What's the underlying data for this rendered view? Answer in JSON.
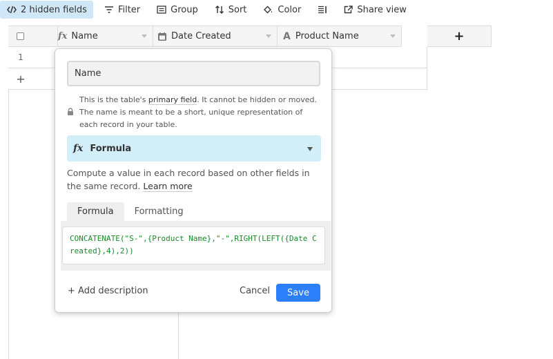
{
  "toolbar": {
    "hidden_fields": "2 hidden fields",
    "filter": "Filter",
    "group": "Group",
    "sort": "Sort",
    "color": "Color",
    "share_view": "Share view"
  },
  "grid": {
    "columns": [
      {
        "name": "Name",
        "icon": "formula-icon"
      },
      {
        "name": "Date Created",
        "icon": "calendar-icon"
      },
      {
        "name": "Product Name",
        "icon": "text-field-icon"
      }
    ],
    "add_column": "+",
    "rows": [
      {
        "number": "1"
      }
    ],
    "add_row": "+"
  },
  "field_editor": {
    "name_value": "Name",
    "primary_note_pre": "This is the table's ",
    "primary_note_em": "primary field",
    "primary_note_post": ". It cannot be hidden or moved. The name is meant to be a short, unique representation of each record in your table.",
    "type_icon": "fx",
    "type_label": "Formula",
    "description": "Compute a value in each record based on other fields in the same record. ",
    "learn_more": "Learn more",
    "tabs": [
      "Formula",
      "Formatting"
    ],
    "active_tab": "Formula",
    "formula": "CONCATENATE(\"S-\",{Product Name},\"-\",RIGHT(LEFT({Date Created},4),2))",
    "add_description": "+ Add description",
    "cancel": "Cancel",
    "save": "Save"
  },
  "colors": {
    "accent": "#2d7ff9",
    "active_toolbar": "#cfe7f7",
    "type_select": "#d2eef8",
    "formula_text": "#1a8a2a"
  }
}
